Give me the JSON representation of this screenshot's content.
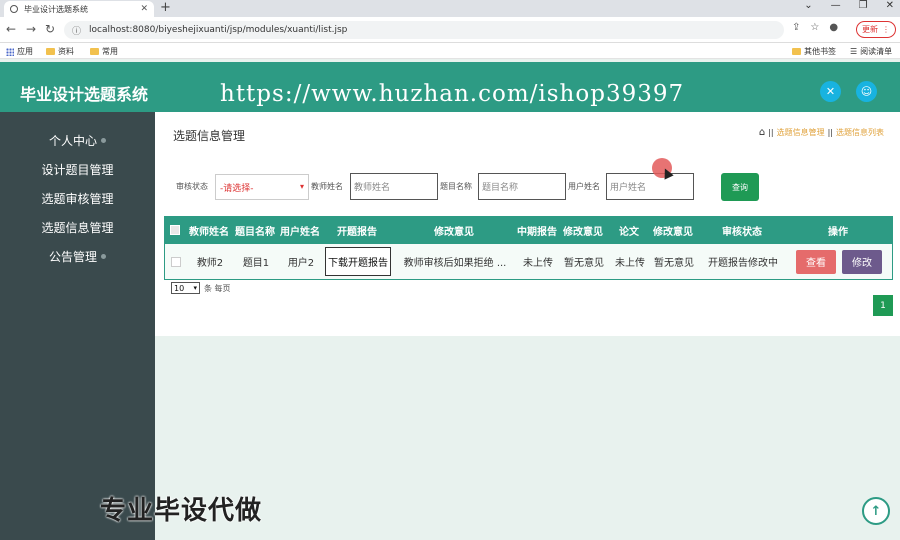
{
  "browser": {
    "tab_title": "毕业设计选题系统",
    "tab_close": "✕",
    "new_tab": "+",
    "url": "localhost:8080/biyeshejixuanti/jsp/modules/xuanti/list.jsp",
    "update_label": "更新",
    "bookmarks": [
      "应用",
      "资料",
      "常用"
    ],
    "bookmarks_right": [
      "其他书签",
      "阅读清单"
    ]
  },
  "header": {
    "title": "毕业设计选题系统",
    "watermark_url": "https://www.huzhan.com/ishop39397"
  },
  "sidebar": {
    "items": [
      "个人中心",
      "设计题目管理",
      "选题审核管理",
      "选题信息管理",
      "公告管理"
    ]
  },
  "page": {
    "title": "选题信息管理",
    "breadcrumb": [
      "选题信息管理",
      "选题信息列表"
    ]
  },
  "filters": {
    "status_label": "审核状态",
    "status_value": "-请选择-",
    "teacher_label": "教师姓名",
    "teacher_placeholder": "教师姓名",
    "topic_label": "题目名称",
    "topic_placeholder": "题目名称",
    "user_label": "用户姓名",
    "user_placeholder": "用户姓名",
    "search_label": "查询"
  },
  "table": {
    "headers": [
      "教师姓名",
      "题目名称",
      "用户姓名",
      "开题报告",
      "修改意见",
      "中期报告",
      "修改意见",
      "论文",
      "修改意见",
      "审核状态",
      "操作"
    ],
    "rows": [
      {
        "teacher": "教师2",
        "topic": "题目1",
        "user": "用户2",
        "proposal_btn": "下载开题报告",
        "opinion1": "教师审核后如果拒绝 ...",
        "midterm": "未上传",
        "opinion2": "暂无意见",
        "thesis": "未上传",
        "opinion3": "暂无意见",
        "status": "开题报告修改中",
        "view_label": "查看",
        "edit_label": "修改"
      }
    ]
  },
  "pagination": {
    "page_size": "10",
    "per_page_label": "条 每页",
    "current_page": "1"
  },
  "overlay": {
    "promo_text": "专业毕设代做"
  }
}
